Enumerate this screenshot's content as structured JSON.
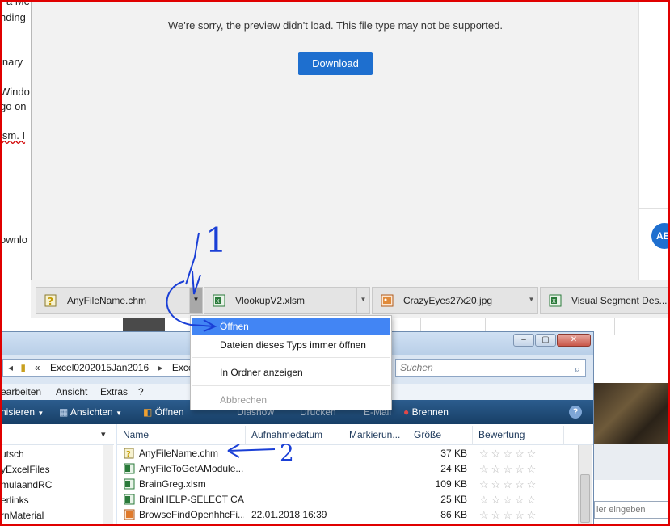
{
  "background_doc": {
    "lines": [
      "r a Me",
      "nding",
      "inary",
      "Windo",
      "go on",
      "lsm. I",
      "ownlo"
    ]
  },
  "preview": {
    "message": "We're sorry, the preview didn't load. This file type may not be supported.",
    "download_label": "Download",
    "avatar_initials": "AE"
  },
  "downloads": [
    {
      "name": "AnyFileName.chm",
      "icon": "chm-help-file-icon"
    },
    {
      "name": "VlookupV2.xlsm",
      "icon": "excel-file-icon"
    },
    {
      "name": "CrazyEyes27x20.jpg",
      "icon": "image-file-icon"
    },
    {
      "name": "Visual Segment Des....x",
      "icon": "excel-file-icon"
    }
  ],
  "context_menu": {
    "items": [
      "Öffnen",
      "Dateien dieses Typs immer öffnen",
      "In Ordner anzeigen",
      "Abbrechen"
    ]
  },
  "explorer": {
    "address": [
      "«",
      "Excel0202015Jan2016",
      "ExcelForu"
    ],
    "search_placeholder": "Suchen",
    "menu": [
      "earbeiten",
      "Ansicht",
      "Extras",
      "?"
    ],
    "toolbar": [
      "nisieren",
      "Ansichten",
      "Öffnen",
      "Diashow",
      "Drucken",
      "E-Mail",
      "Brennen"
    ],
    "nav_items": [
      "utsch",
      "yExcelFiles",
      "mulaandRC",
      "erlinks",
      "rnMaterial"
    ],
    "columns": [
      "Name",
      "Aufnahmedatum",
      "Markierun...",
      "Größe",
      "Bewertung"
    ],
    "files": [
      {
        "name": "AnyFileName.chm",
        "date": "",
        "size": "37 KB",
        "icon": "chm-help-file-icon"
      },
      {
        "name": "AnyFileToGetAModule...",
        "date": "",
        "size": "24 KB",
        "icon": "excel-file-icon"
      },
      {
        "name": "BrainGreg.xlsm",
        "date": "",
        "size": "109 KB",
        "icon": "excel-file-icon"
      },
      {
        "name": "BrainHELP-SELECT CA...",
        "date": "",
        "size": "25 KB",
        "icon": "excel-file-icon"
      },
      {
        "name": "BrowseFindOpenhhcFi...",
        "date": "22.01.2018 16:39",
        "size": "86 KB",
        "icon": "office-file-icon"
      }
    ],
    "rating_stars": "☆☆☆☆☆"
  },
  "side_panel": {
    "input_text": "ier eingeben"
  },
  "annotations": {
    "label_1": "1",
    "label_2": "2"
  },
  "colors": {
    "accent_blue": "#1e6fcf",
    "menu_highlight": "#4285f4",
    "frame_red": "#e00000",
    "annotation_blue": "#1a3fd6"
  }
}
